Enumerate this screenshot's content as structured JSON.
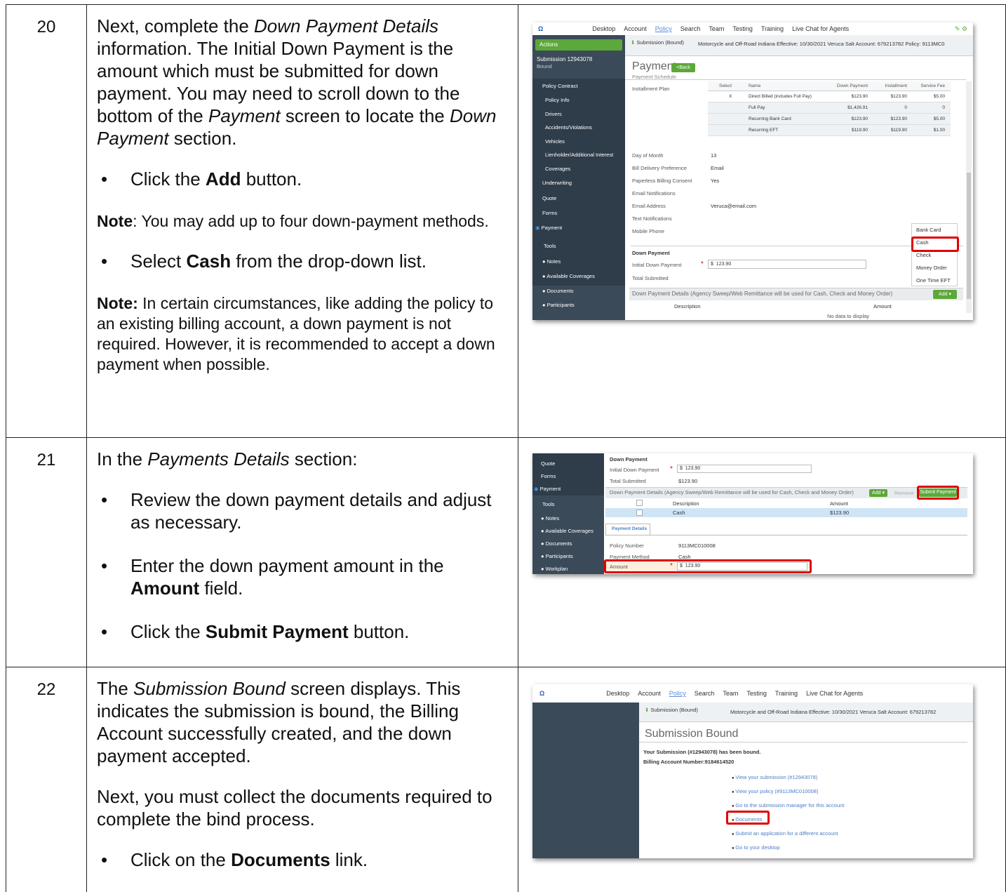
{
  "rows": [
    {
      "number": "20",
      "intro_pre": "Next, complete the ",
      "intro_em": "Down Payment Details",
      "intro_post": " information. The Initial Down Payment is the amount which must be submitted for down payment. You may need to scroll down to the bottom of the ",
      "intro_em2": "Payment",
      "intro_post2": " screen to locate the ",
      "intro_em3": "Down Payment",
      "intro_post3": " section.",
      "bullet1_pre": "Click the ",
      "bullet1_bold": "Add",
      "bullet1_post": " button.",
      "note1_label": "Note",
      "note1_text": ":  You may add up to four down-payment methods.",
      "bullet2_pre": "Select ",
      "bullet2_bold": "Cash",
      "bullet2_post": " from the drop-down list.",
      "note2_label": "Note:",
      "note2_text": " In certain circumstances, like adding the policy to an existing billing account, a down payment is not required. However, it is recommended to accept a down payment when possible."
    },
    {
      "number": "21",
      "intro_pre": "In the ",
      "intro_em": "Payments Details",
      "intro_post": " section:",
      "bullet1": "Review the down payment details and adjust as necessary.",
      "bullet2_pre": "Enter the down payment amount in the ",
      "bullet2_bold": "Amount",
      "bullet2_post": " field.",
      "bullet3_pre": "Click the ",
      "bullet3_bold": "Submit Payment",
      "bullet3_post": " button."
    },
    {
      "number": "22",
      "intro_pre": "The ",
      "intro_em": "Submission Bound",
      "intro_post": " screen displays. This indicates the submission is bound, the Billing Account successfully created, and the down payment accepted.",
      "para2": "Next, you must collect the documents required to complete the bind process.",
      "bullet1_pre": "Click on the ",
      "bullet1_bold": "Documents",
      "bullet1_post": " link."
    }
  ],
  "shot1": {
    "nav": [
      "Desktop",
      "Account",
      "Policy",
      "Search",
      "Team",
      "Testing",
      "Training",
      "Live Chat for Agents"
    ],
    "actions": "Actions",
    "submission": "Submission 12943078",
    "bound": "Bound",
    "sub_bar": "Submission (Bound)",
    "sub_info": "Motorcycle and Off-Road  Indiana  Effective: 10/30/2021  Veruca Salt  Account: 679213782  Policy: 9113MC0",
    "title": "Payment",
    "back": "<Back",
    "payment_schedule": "Payment Schedule",
    "sidebar_items": [
      "Policy Contract",
      "Policy Info",
      "Drivers",
      "Accidents/Violations",
      "Vehicles",
      "Lienholder/Additional Interest",
      "Coverages",
      "Underwriting",
      "Quote",
      "Forms",
      "Payment",
      "Tools",
      "Notes",
      "Available Coverages",
      "Documents",
      "Participants"
    ],
    "installment_plan": "Installment Plan",
    "headers": [
      "Select",
      "Name",
      "Down Payment",
      "Installment",
      "Service Fee"
    ],
    "plans": [
      {
        "sel": "X",
        "name": "Direct Billed (includes Full Pay)",
        "down": "$123.90",
        "inst": "$123.90",
        "fee": "$5.00"
      },
      {
        "sel": "",
        "name": "Full Pay",
        "down": "$1,426.91",
        "inst": "0",
        "fee": "0"
      },
      {
        "sel": "",
        "name": "Recurring Bank Card",
        "down": "$123.90",
        "inst": "$123.90",
        "fee": "$5.00"
      },
      {
        "sel": "",
        "name": "Recurring EFT",
        "down": "$119.90",
        "inst": "$119.90",
        "fee": "$1.00"
      }
    ],
    "fields": [
      {
        "label": "Day of Month",
        "value": "13"
      },
      {
        "label": "Bill Delivery Preference",
        "value": "Email"
      },
      {
        "label": "Paperless Billing Consent",
        "value": "Yes"
      },
      {
        "label": "Email Notifications",
        "value": ""
      },
      {
        "label": "Email Address",
        "value": "Veruca@email.com"
      },
      {
        "label": "Text Notifications",
        "value": ""
      },
      {
        "label": "Mobile Phone",
        "value": ""
      }
    ],
    "down_payment": "Down Payment",
    "initial_down": "Initial Down Payment",
    "initial_value": "123.90",
    "total_submitted": "Total Submitted",
    "details_header": "Down Payment Details (Agency Sweep/Web Remittance will be used for Cash, Check and Money Order)",
    "add": "Add",
    "description": "Description",
    "amount": "Amount",
    "no_data": "No data to display",
    "dropdown": [
      "Bank Card",
      "Cash",
      "Check",
      "Money Order",
      "One Time EFT"
    ]
  },
  "shot2": {
    "sidebar_items": [
      "Quote",
      "Forms",
      "Payment",
      "Tools",
      "Notes",
      "Available Coverages",
      "Documents",
      "Participants",
      "Workplan"
    ],
    "down_payment": "Down Payment",
    "initial_down": "Initial Down Payment",
    "initial_value": "123.90",
    "total_submitted": "Total Submitted",
    "total_value": "$123.90",
    "details_header": "Down Payment Details (Agency Sweep/Web Remittance will be used for Cash, Check and Money Order)",
    "add": "Add",
    "remove": "Remove",
    "submit": "Submit Payment",
    "description": "Description",
    "amount": "Amount",
    "row_desc": "Cash",
    "row_amount": "$123.90",
    "tab": "Payment Details",
    "policy_number_label": "Policy Number",
    "policy_number": "9113MC010008",
    "method_label": "Payment Method",
    "method": "Cash",
    "amount_label": "Amount",
    "amount_value": "123.90"
  },
  "shot3": {
    "nav": [
      "Desktop",
      "Account",
      "Policy",
      "Search",
      "Team",
      "Testing",
      "Training",
      "Live Chat for Agents"
    ],
    "sub_bar": "Submission (Bound)",
    "sub_info": "Motorcycle and Off-Road  Indiana  Effective: 10/30/2021  Veruca Salt  Account: 679213782",
    "title": "Submission Bound",
    "msg1": "Your Submission (#12943078) has been bound.",
    "msg2": "Billing Account Number:9184614520",
    "links": [
      "View your submission (#12943078)",
      "View your policy (#9113MC010008)",
      "Go to the submission manager for this account",
      "Documents",
      "Submit an application for a different account",
      "Go to your desktop"
    ]
  }
}
